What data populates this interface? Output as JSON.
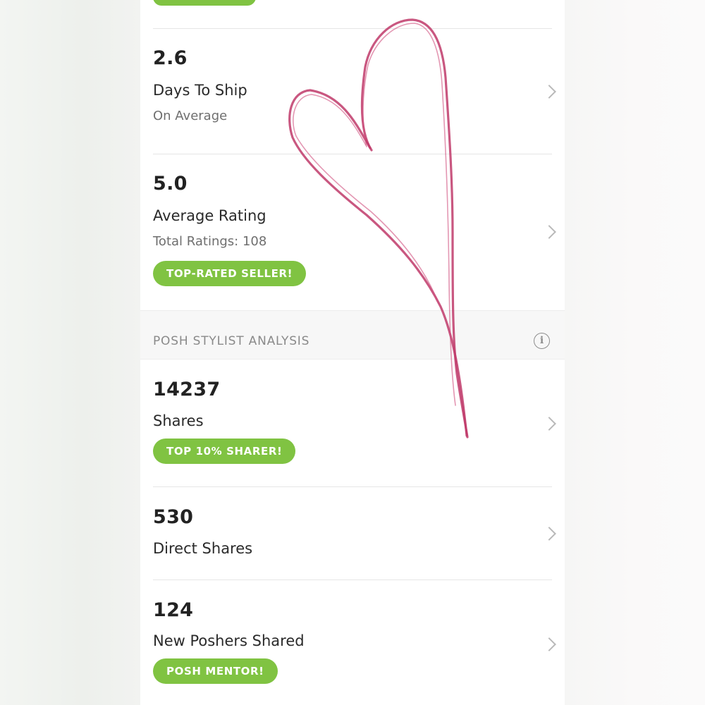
{
  "stats_top": [
    {
      "value": "2.6",
      "label": "Days To Ship",
      "sublabel": "On Average"
    },
    {
      "value": "5.0",
      "label": "Average Rating",
      "sublabel": "Total Ratings: 108",
      "badge": "TOP-RATED SELLER!"
    }
  ],
  "section": {
    "title": "POSH STYLIST ANALYSIS",
    "info_icon": "info-icon"
  },
  "stats_bottom": [
    {
      "value": "14237",
      "label": "Shares",
      "badge": "TOP 10% SHARER!"
    },
    {
      "value": "530",
      "label": "Direct Shares"
    },
    {
      "value": "124",
      "label": "New Poshers Shared",
      "badge": "POSH MENTOR!"
    }
  ],
  "icons": {
    "chevron": "chevron-right-icon",
    "info": "info-icon",
    "overlay": "heart-drawing"
  },
  "colors": {
    "badge_green": "#80c342",
    "heart_stroke": "#c0396a",
    "section_bg": "#f7f7f7"
  }
}
